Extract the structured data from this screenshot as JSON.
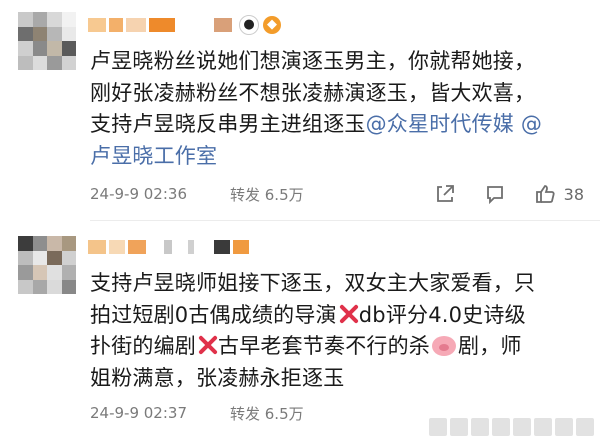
{
  "comments": [
    {
      "lines": [
        "卢昱晓粉丝说她们想演逐玉男主，你就帮她接，",
        "刚好张凌赫粉丝不想张凌赫演逐玉，皆大欢喜，",
        "支持卢昱晓反串男主进组逐玉",
        "@众星时代传媒 @",
        "卢昱晓工作室"
      ],
      "timestamp": "24-9-9 02:36",
      "repost": "转发 6.5万",
      "likes": "38"
    },
    {
      "segments": [
        "支持卢昱晓师姐接下逐玉，双女主大家爱看，只",
        "拍过短剧0古偶成绩的导演",
        "db评分4.0史诗级",
        "扑街的编剧",
        "古早老套节奏不行的杀",
        "剧，师",
        "姐粉满意，张凌赫永拒逐玉"
      ],
      "timestamp": "24-9-9 02:37",
      "repost": "转发 6.5万"
    }
  ],
  "colors": {
    "mention": "#4a6ea8",
    "meta": "#7a7a7a",
    "cross": "#e0314a",
    "badge_orange": "#f39c2a"
  },
  "icons": [
    "share-icon",
    "comment-icon",
    "like-icon",
    "panda-badge-icon",
    "fish-badge-icon",
    "cross-mark-icon",
    "pig-face-icon"
  ]
}
